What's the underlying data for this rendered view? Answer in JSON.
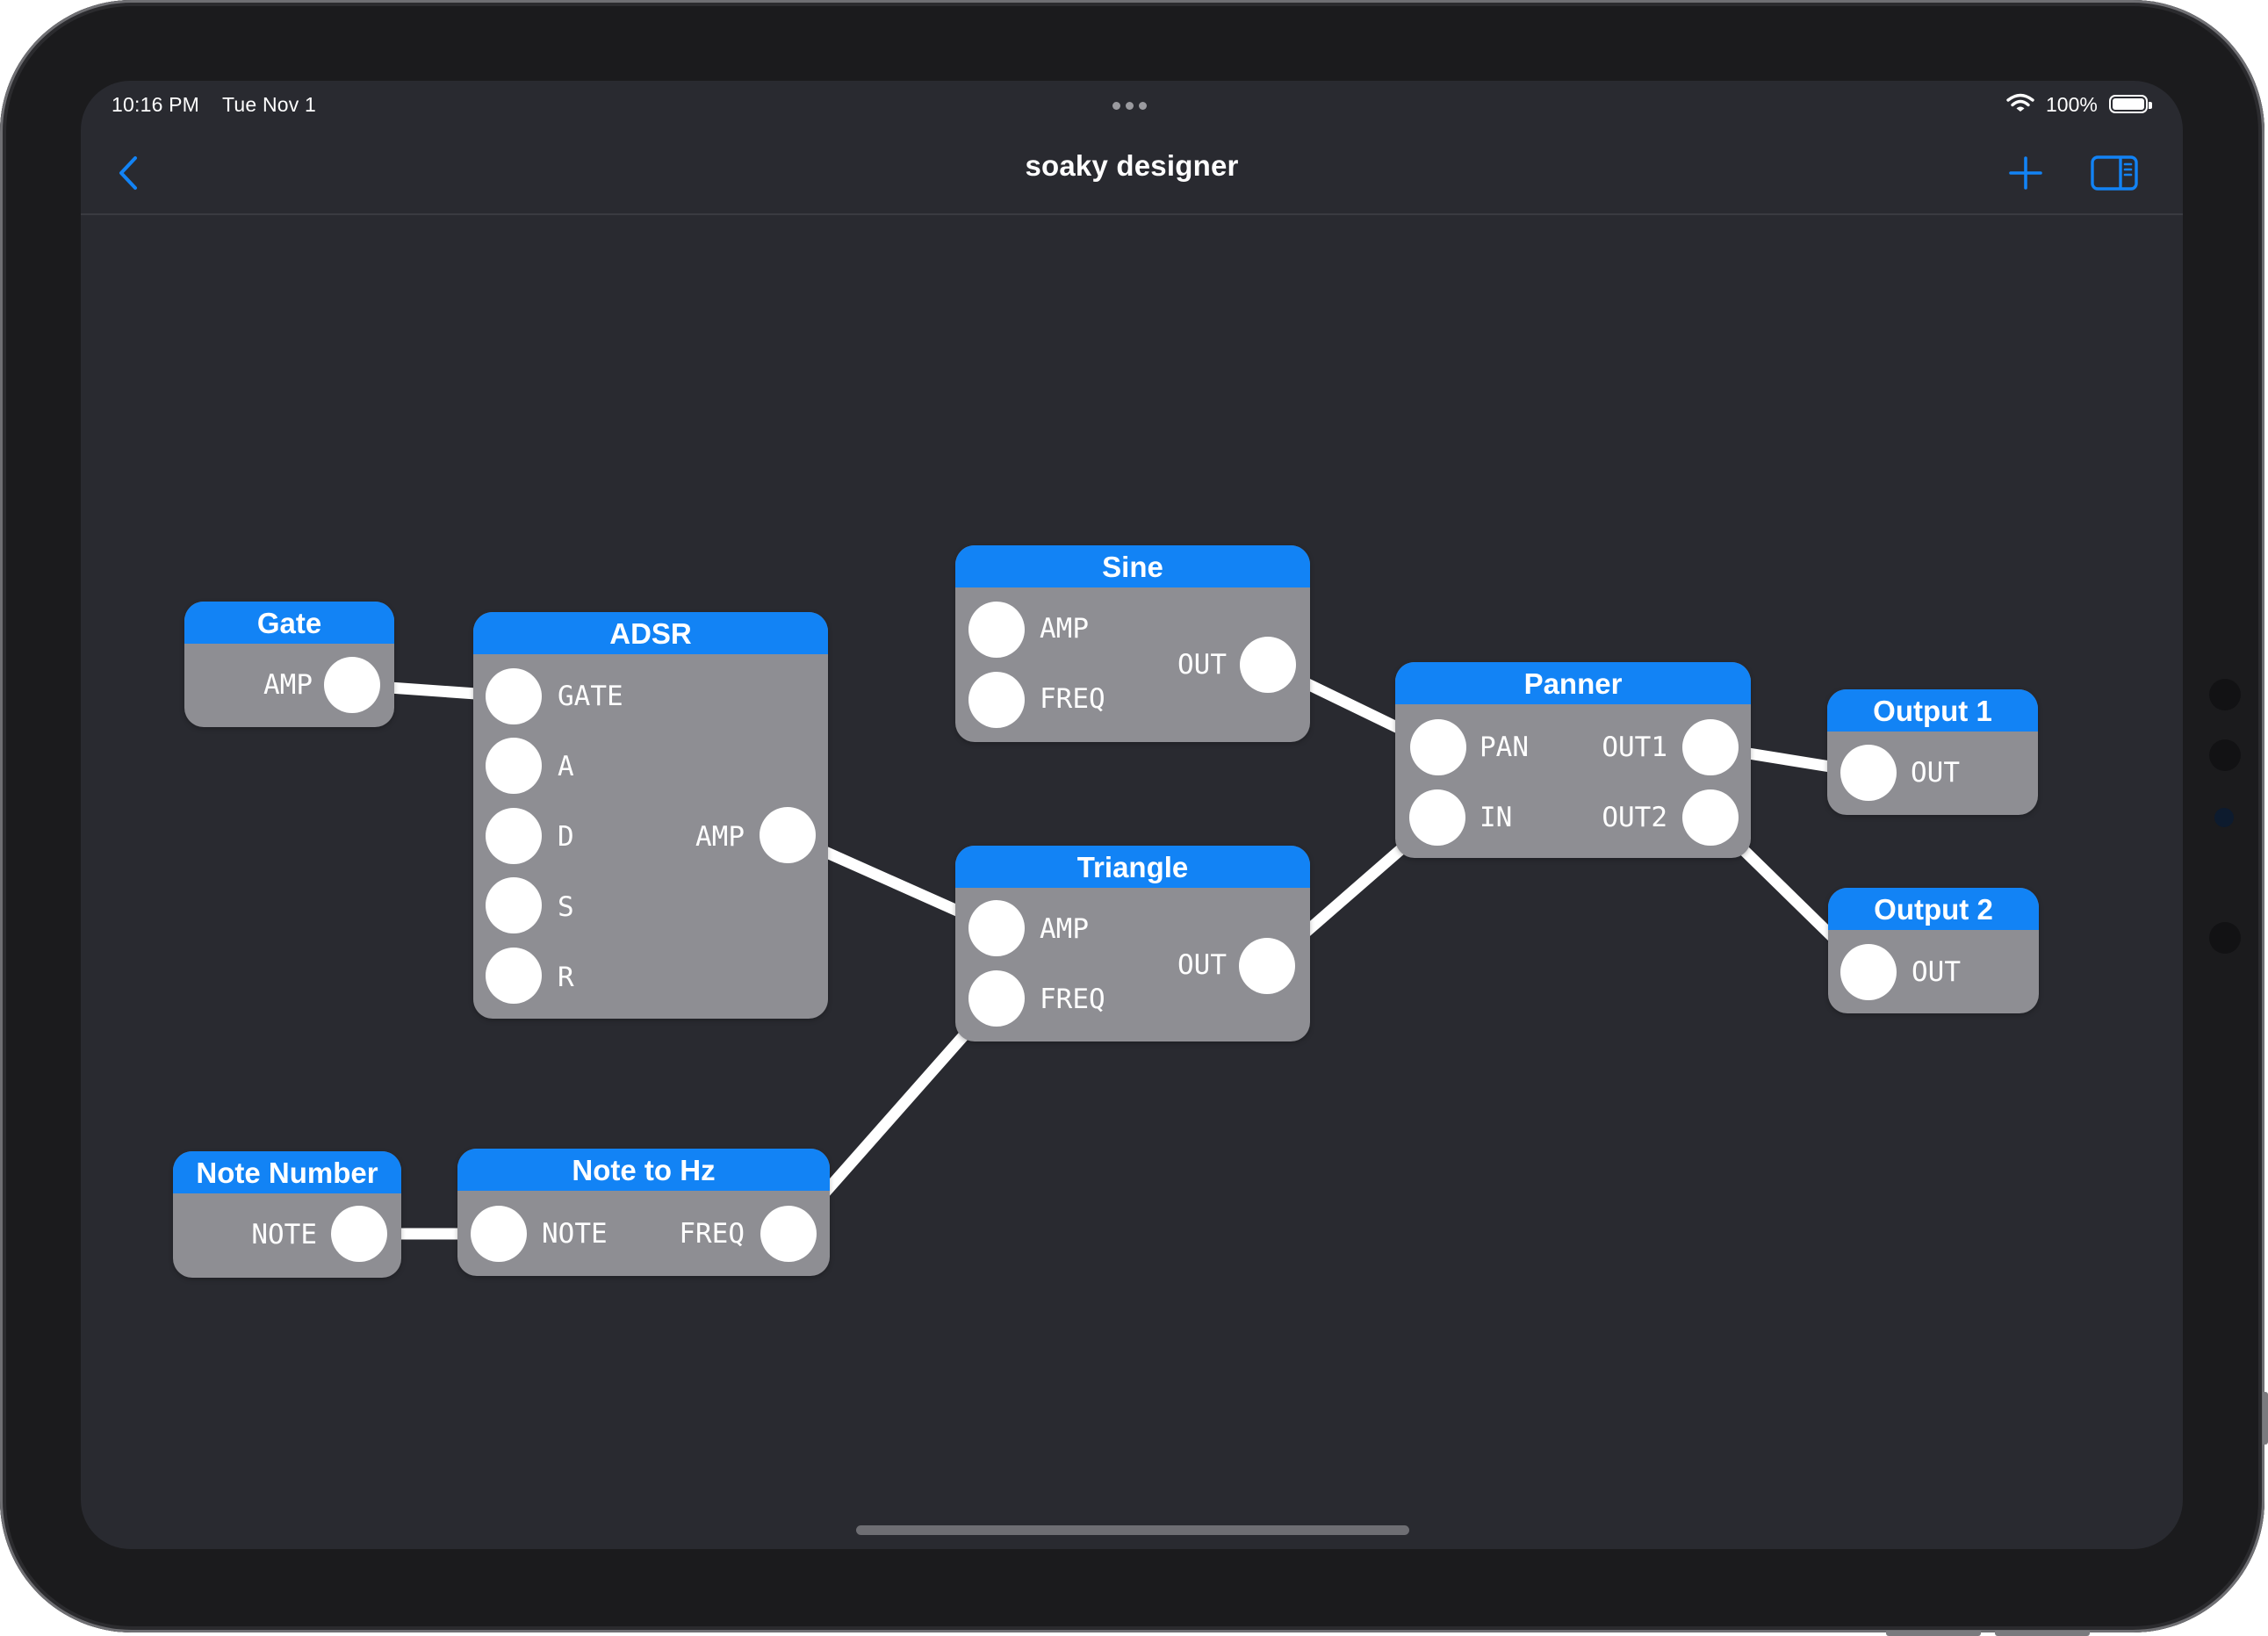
{
  "status_bar": {
    "time": "10:16 PM",
    "date": "Tue Nov 1",
    "battery": "100%",
    "icons": [
      "multitasking-dots-icon",
      "wifi-icon",
      "battery-icon"
    ]
  },
  "nav": {
    "title": "soaky designer",
    "back_icon": "chevron-left-icon",
    "add_icon": "plus-icon",
    "sidebar_icon": "sidebar-right-icon"
  },
  "colors": {
    "accent": "#1283f5",
    "canvas_bg": "#292a30",
    "node_body": "#8e8e93",
    "port": "#ffffff",
    "wire": "#ffffff"
  },
  "nodes": {
    "gate": {
      "title": "Gate",
      "outputs": [
        "AMP"
      ]
    },
    "adsr": {
      "title": "ADSR",
      "inputs": [
        "GATE",
        "A",
        "D",
        "S",
        "R"
      ],
      "outputs": [
        "AMP"
      ]
    },
    "sine": {
      "title": "Sine",
      "inputs": [
        "AMP",
        "FREQ"
      ],
      "outputs": [
        "OUT"
      ]
    },
    "triangle": {
      "title": "Triangle",
      "inputs": [
        "AMP",
        "FREQ"
      ],
      "outputs": [
        "OUT"
      ]
    },
    "panner": {
      "title": "Panner",
      "inputs": [
        "PAN",
        "IN"
      ],
      "outputs": [
        "OUT1",
        "OUT2"
      ]
    },
    "output1": {
      "title": "Output 1",
      "inputs": [
        "OUT"
      ]
    },
    "output2": {
      "title": "Output 2",
      "inputs": [
        "OUT"
      ]
    },
    "note_number": {
      "title": "Note Number",
      "outputs": [
        "NOTE"
      ]
    },
    "note_to_hz": {
      "title": "Note to Hz",
      "inputs": [
        "NOTE"
      ],
      "outputs": [
        "FREQ"
      ]
    }
  },
  "connections": [
    {
      "from": "gate.AMP",
      "to": "adsr.GATE"
    },
    {
      "from": "adsr.AMP",
      "to": "triangle.AMP"
    },
    {
      "from": "sine.OUT",
      "to": "panner.PAN"
    },
    {
      "from": "triangle.OUT",
      "to": "panner.IN"
    },
    {
      "from": "panner.OUT1",
      "to": "output1.OUT"
    },
    {
      "from": "panner.OUT2",
      "to": "output2.OUT"
    },
    {
      "from": "note_number.NOTE",
      "to": "note_to_hz.NOTE"
    },
    {
      "from": "note_to_hz.FREQ",
      "to": "triangle.FREQ"
    }
  ]
}
